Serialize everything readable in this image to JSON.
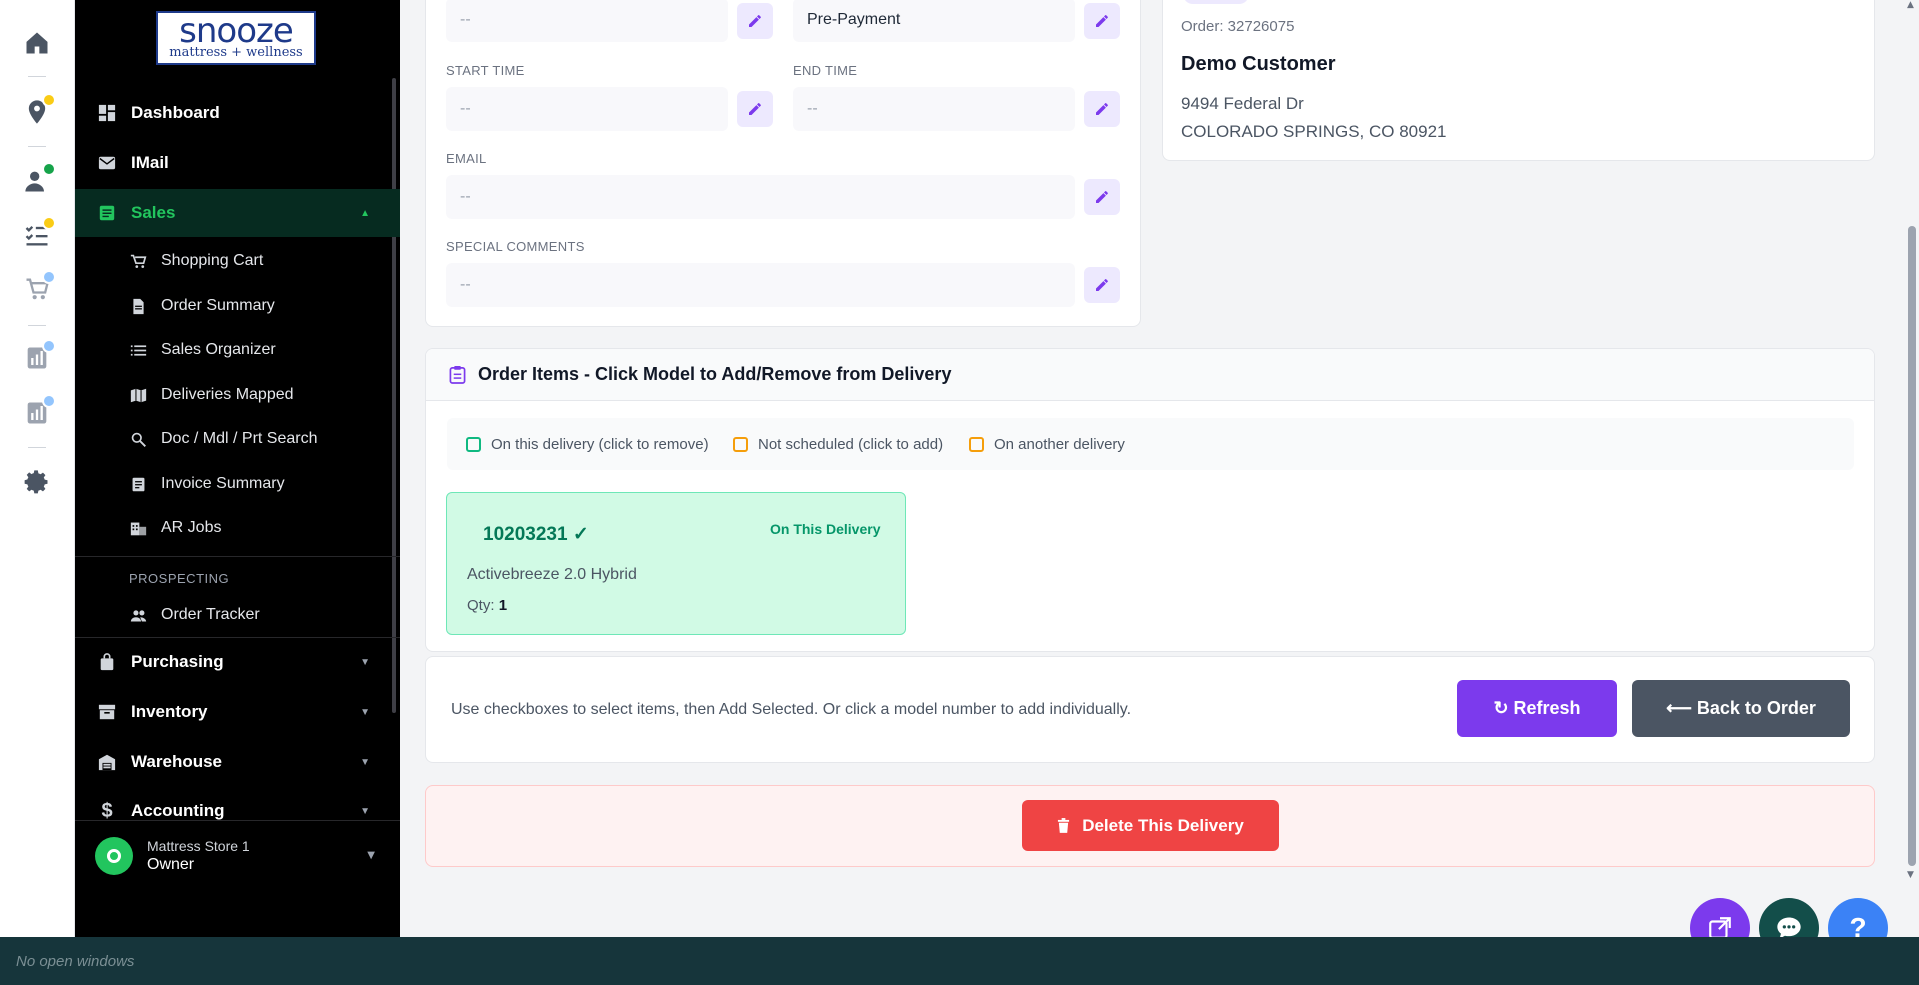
{
  "brand": {
    "logo_top": "snooze",
    "logo_bottom": "mattress + wellness"
  },
  "sidebar": {
    "items": [
      {
        "label": "Dashboard"
      },
      {
        "label": "IMail"
      },
      {
        "label": "Sales"
      },
      {
        "label": "Purchasing"
      },
      {
        "label": "Inventory"
      },
      {
        "label": "Warehouse"
      },
      {
        "label": "Accounting"
      }
    ],
    "sales_sub": [
      {
        "label": "Shopping Cart"
      },
      {
        "label": "Order Summary"
      },
      {
        "label": "Sales Organizer"
      },
      {
        "label": "Deliveries Mapped"
      },
      {
        "label": "Doc / Mdl / Prt Search"
      },
      {
        "label": "Invoice Summary"
      },
      {
        "label": "AR Jobs"
      }
    ],
    "section_prospecting": "PROSPECTING",
    "order_tracker": "Order Tracker",
    "user": {
      "store": "Mattress Store 1",
      "role": "Owner"
    }
  },
  "form": {
    "top_left_value": "--",
    "payment_value": "Pre-Payment",
    "start_time_label": "START TIME",
    "start_time_value": "--",
    "end_time_label": "END TIME",
    "end_time_value": "--",
    "email_label": "EMAIL",
    "email_value": "--",
    "comments_label": "SPECIAL COMMENTS",
    "comments_value": "--"
  },
  "customer": {
    "order": "Order: 32726075",
    "name": "Demo Customer",
    "address1": "9494 Federal Dr",
    "address2": "COLORADO SPRINGS, CO 80921"
  },
  "order_items": {
    "title": "Order Items - Click Model to Add/Remove from Delivery",
    "legend": [
      {
        "label": "On this delivery (click to remove)",
        "color": "#10b981"
      },
      {
        "label": "Not scheduled (click to add)",
        "color": "#f59e0b"
      },
      {
        "label": "On another delivery",
        "color": "#f59e0b"
      }
    ],
    "item": {
      "model": "10203231 ✓",
      "status": "On This Delivery",
      "description": "Activebreeze 2.0 Hybrid",
      "qty_label": "Qty:",
      "qty": "1"
    }
  },
  "actions": {
    "hint": "Use checkboxes to select items, then Add Selected. Or click a model number to add individually.",
    "refresh": "↻ Refresh",
    "back": "⟵ Back to Order",
    "delete": "Delete This Delivery"
  },
  "taskbar": {
    "text": "No open windows"
  },
  "colors": {
    "accent_purple": "#7c3aed",
    "sales_green": "#22c55e",
    "delete_red": "#ef4444"
  }
}
